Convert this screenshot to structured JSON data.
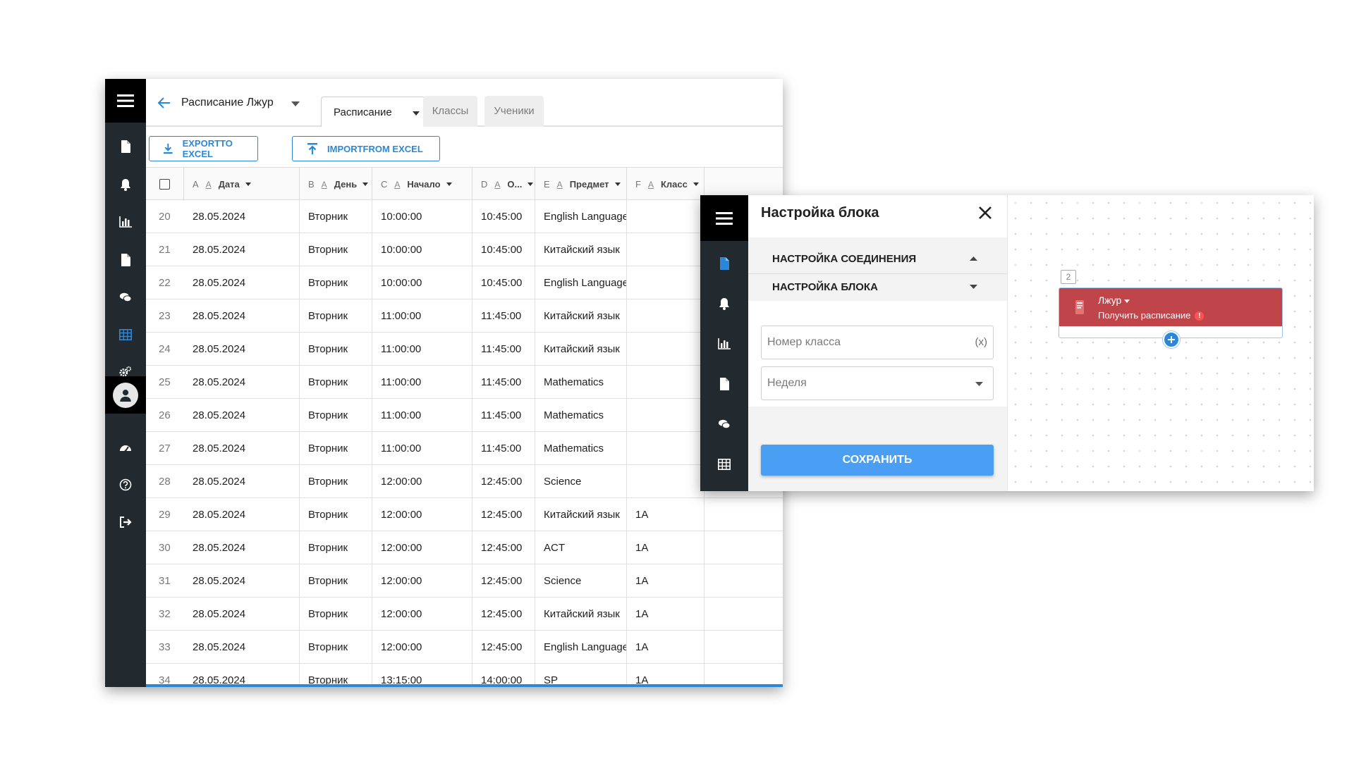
{
  "spreadsheet": {
    "title": "Расписание Лжур",
    "tabs": {
      "active": "Расписание",
      "classes": "Классы",
      "students": "Ученики"
    },
    "toolbar": {
      "export_label": "EXPORTTO EXCEL",
      "import_label": "IMPORTFROM EXCEL"
    },
    "columns": [
      {
        "letter": "A",
        "label": "Дата"
      },
      {
        "letter": "B",
        "label": "День"
      },
      {
        "letter": "C",
        "label": "Начало"
      },
      {
        "letter": "D",
        "label": "О..."
      },
      {
        "letter": "E",
        "label": "Предмет"
      },
      {
        "letter": "F",
        "label": "Класс"
      }
    ],
    "column_filter_glyph": "A",
    "rows": [
      {
        "n": "20",
        "date": "28.05.2024",
        "day": "Вторник",
        "start": "10:00:00",
        "end": "10:45:00",
        "subject": "English Language",
        "class": ""
      },
      {
        "n": "21",
        "date": "28.05.2024",
        "day": "Вторник",
        "start": "10:00:00",
        "end": "10:45:00",
        "subject": "Китайский язык",
        "class": ""
      },
      {
        "n": "22",
        "date": "28.05.2024",
        "day": "Вторник",
        "start": "10:00:00",
        "end": "10:45:00",
        "subject": "English Language",
        "class": ""
      },
      {
        "n": "23",
        "date": "28.05.2024",
        "day": "Вторник",
        "start": "11:00:00",
        "end": "11:45:00",
        "subject": "Китайский язык",
        "class": ""
      },
      {
        "n": "24",
        "date": "28.05.2024",
        "day": "Вторник",
        "start": "11:00:00",
        "end": "11:45:00",
        "subject": "Китайский язык",
        "class": ""
      },
      {
        "n": "25",
        "date": "28.05.2024",
        "day": "Вторник",
        "start": "11:00:00",
        "end": "11:45:00",
        "subject": "Mathematics",
        "class": ""
      },
      {
        "n": "26",
        "date": "28.05.2024",
        "day": "Вторник",
        "start": "11:00:00",
        "end": "11:45:00",
        "subject": "Mathematics",
        "class": ""
      },
      {
        "n": "27",
        "date": "28.05.2024",
        "day": "Вторник",
        "start": "11:00:00",
        "end": "11:45:00",
        "subject": "Mathematics",
        "class": ""
      },
      {
        "n": "28",
        "date": "28.05.2024",
        "day": "Вторник",
        "start": "12:00:00",
        "end": "12:45:00",
        "subject": "Science",
        "class": ""
      },
      {
        "n": "29",
        "date": "28.05.2024",
        "day": "Вторник",
        "start": "12:00:00",
        "end": "12:45:00",
        "subject": "Китайский язык",
        "class": "1A"
      },
      {
        "n": "30",
        "date": "28.05.2024",
        "day": "Вторник",
        "start": "12:00:00",
        "end": "12:45:00",
        "subject": "ACT",
        "class": "1A"
      },
      {
        "n": "31",
        "date": "28.05.2024",
        "day": "Вторник",
        "start": "12:00:00",
        "end": "12:45:00",
        "subject": "Science",
        "class": "1A"
      },
      {
        "n": "32",
        "date": "28.05.2024",
        "day": "Вторник",
        "start": "12:00:00",
        "end": "12:45:00",
        "subject": "Китайский язык",
        "class": "1A"
      },
      {
        "n": "33",
        "date": "28.05.2024",
        "day": "Вторник",
        "start": "12:00:00",
        "end": "12:45:00",
        "subject": "English Language",
        "class": "1A"
      },
      {
        "n": "34",
        "date": "28.05.2024",
        "day": "Вторник",
        "start": "13:15:00",
        "end": "14:00:00",
        "subject": "SP",
        "class": "1A"
      }
    ]
  },
  "block_settings": {
    "title": "Настройка блока",
    "sections": {
      "connection": "НАСТРОЙКА СОЕДИНЕНИЯ",
      "block": "НАСТРОЙКА БЛОКА"
    },
    "fields": {
      "class_number_placeholder": "Номер класса",
      "class_number_suffix": "(x)",
      "week_placeholder": "Неделя"
    },
    "save_label": "СОХРАНИТЬ"
  },
  "canvas": {
    "node_number": "2",
    "node_name": "Лжур",
    "node_action": "Получить расписание",
    "node_warning": "!"
  },
  "colors": {
    "accent": "#2b88d8",
    "sidebar": "#232a2f",
    "node": "#c0454a",
    "save_button": "#4a9ff5"
  },
  "icons": {
    "sidebar": [
      "menu-icon",
      "document-icon",
      "bell-icon",
      "bar-chart-icon",
      "document-icon",
      "chat-icon",
      "table-icon",
      "settings-icon",
      "user-avatar-icon",
      "dashboard-icon",
      "help-icon",
      "logout-icon"
    ]
  }
}
